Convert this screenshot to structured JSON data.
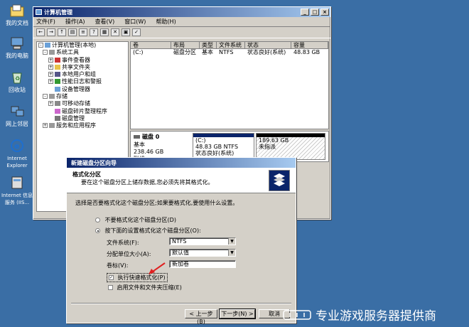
{
  "desktop": {
    "icons": [
      {
        "label": "我的文档",
        "icon": "my-documents-icon"
      },
      {
        "label": "我的电脑",
        "icon": "my-computer-icon"
      },
      {
        "label": "回收站",
        "icon": "recycle-bin-icon"
      },
      {
        "label": "网上邻居",
        "icon": "network-places-icon"
      },
      {
        "label": "Internet Explorer",
        "icon": "ie-icon"
      },
      {
        "label": "Internet 信息服务 (IIS...",
        "icon": "iis-icon"
      }
    ]
  },
  "main_window": {
    "title": "计算机管理",
    "menu": [
      "文件(F)",
      "操作(A)",
      "查看(V)",
      "窗口(W)",
      "帮助(H)"
    ],
    "tree": [
      {
        "label": "计算机管理(本地)",
        "level": 0,
        "expander": "-"
      },
      {
        "label": "系统工具",
        "level": 1,
        "expander": "-"
      },
      {
        "label": "事件查看器",
        "level": 2,
        "expander": "+"
      },
      {
        "label": "共享文件夹",
        "level": 2,
        "expander": "+"
      },
      {
        "label": "本地用户和组",
        "level": 2,
        "expander": "+"
      },
      {
        "label": "性能日志和警报",
        "level": 2,
        "expander": "+"
      },
      {
        "label": "设备管理器",
        "level": 2,
        "expander": ""
      },
      {
        "label": "存储",
        "level": 1,
        "expander": "-"
      },
      {
        "label": "可移动存储",
        "level": 2,
        "expander": "+"
      },
      {
        "label": "磁盘碎片整理程序",
        "level": 2,
        "expander": ""
      },
      {
        "label": "磁盘管理",
        "level": 2,
        "expander": ""
      },
      {
        "label": "服务和应用程序",
        "level": 1,
        "expander": "+"
      }
    ],
    "columns": [
      "卷",
      "布局",
      "类型",
      "文件系统",
      "状态",
      "容量"
    ],
    "rows": [
      [
        "(C:)",
        "磁盘分区",
        "基本",
        "NTFS",
        "状态良好(系统)",
        "48.83 GB"
      ]
    ],
    "disk": {
      "name": "磁盘 0",
      "type": "基本",
      "size": "238.46 GB",
      "status": "联机",
      "partitions": [
        {
          "line1": "(C:)",
          "line2": "48.83 GB NTFS",
          "line3": "状态良好(系统)"
        },
        {
          "line1": "",
          "line2": "189.63 GB",
          "line3": "未指派"
        }
      ]
    }
  },
  "wizard": {
    "title": "新建磁盘分区向导",
    "heading": "格式化分区",
    "subheading": "要在这个磁盘分区上储存数据,您必须先将其格式化。",
    "prompt": "选择是否要格式化这个磁盘分区;如果要格式化,要使用什么设置。",
    "option_no": "不要格式化这个磁盘分区(D)",
    "option_yes": "按下面的设置格式化这个磁盘分区(O):",
    "fs_label": "文件系统(F):",
    "fs_value": "NTFS",
    "alloc_label": "分配单位大小(A):",
    "alloc_value": "默认值",
    "vol_label": "卷标(V):",
    "vol_value": "新加卷",
    "quick_format": "执行快速格式化(P)",
    "compression": "启用文件和文件夹压缩(E)",
    "back": "< 上一步(B)",
    "next": "下一步(N) >",
    "cancel": "取消"
  },
  "watermark": "专业游戏服务器提供商"
}
